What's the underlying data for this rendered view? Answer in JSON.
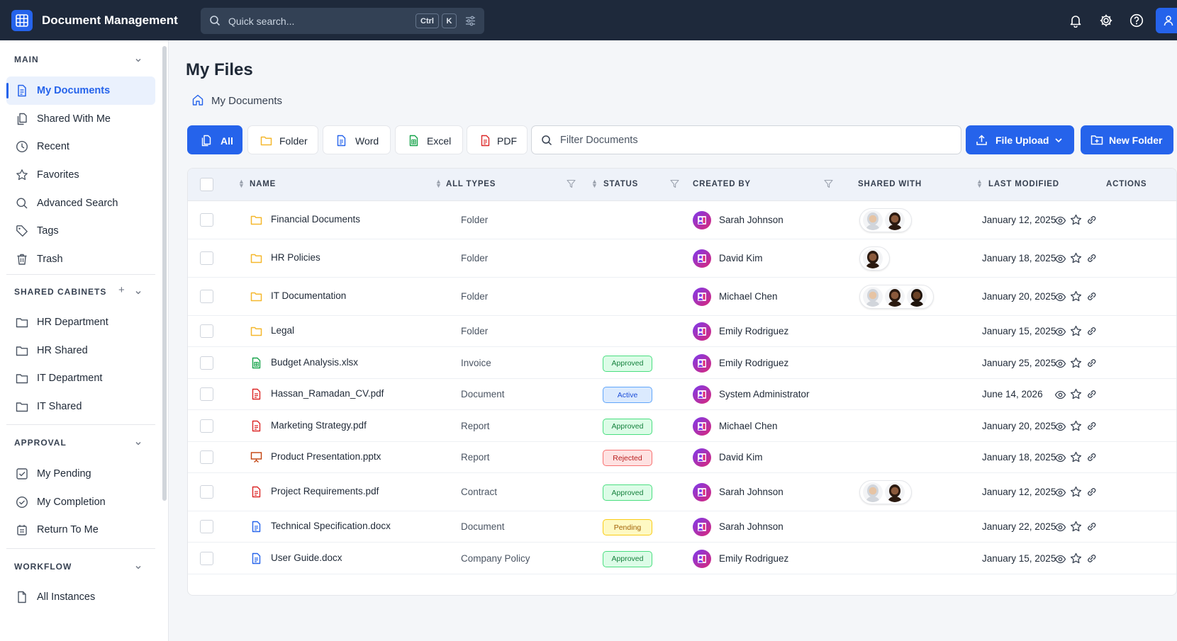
{
  "app": {
    "title": "Document Management"
  },
  "search": {
    "placeholder": "Quick search...",
    "kbd_ctrl": "Ctrl",
    "kbd_k": "K"
  },
  "sidebar": {
    "sections": [
      {
        "title": "MAIN",
        "items": [
          {
            "label": "My Documents",
            "icon": "document-icon",
            "active": true
          },
          {
            "label": "Shared With Me",
            "icon": "shared-files-icon"
          },
          {
            "label": "Recent",
            "icon": "clock-icon"
          },
          {
            "label": "Favorites",
            "icon": "star-icon"
          },
          {
            "label": "Advanced Search",
            "icon": "search-icon"
          },
          {
            "label": "Tags",
            "icon": "tag-icon"
          },
          {
            "label": "Trash",
            "icon": "trash-icon"
          }
        ]
      },
      {
        "title": "SHARED CABINETS",
        "items": [
          {
            "label": "HR Department",
            "icon": "folder-icon"
          },
          {
            "label": "HR Shared",
            "icon": "folder-icon"
          },
          {
            "label": "IT Department",
            "icon": "folder-icon"
          },
          {
            "label": "IT Shared",
            "icon": "folder-icon"
          }
        ]
      },
      {
        "title": "APPROVAL",
        "items": [
          {
            "label": "My Pending",
            "icon": "checkbox-icon"
          },
          {
            "label": "My Completion",
            "icon": "check-circle-icon"
          },
          {
            "label": "Return To Me",
            "icon": "return-icon"
          }
        ]
      },
      {
        "title": "WORKFLOW",
        "items": [
          {
            "label": "All Instances",
            "icon": "instances-icon"
          }
        ]
      }
    ]
  },
  "main": {
    "title": "My Files",
    "breadcrumb": "My Documents",
    "filters": [
      {
        "label": "All",
        "icon": "files-icon",
        "active": true
      },
      {
        "label": "Folder",
        "icon": "folder-icon"
      },
      {
        "label": "Word",
        "icon": "word-icon"
      },
      {
        "label": "Excel",
        "icon": "excel-icon"
      },
      {
        "label": "PDF",
        "icon": "pdf-icon"
      }
    ],
    "filter_placeholder": "Filter Documents",
    "upload_label": "File Upload",
    "new_folder_label": "New Folder"
  },
  "table": {
    "headers": {
      "name": "NAME",
      "types": "ALL TYPES",
      "status": "STATUS",
      "created_by": "CREATED BY",
      "shared_with": "SHARED WITH",
      "last_modified": "LAST MODIFIED",
      "actions": "ACTIONS"
    },
    "rows": [
      {
        "name": "Financial Documents",
        "kind": "folder",
        "type": "Folder",
        "status": "",
        "creator": "Sarah Johnson",
        "shared": 2,
        "modified": "January 12, 2025"
      },
      {
        "name": "HR Policies",
        "kind": "folder",
        "type": "Folder",
        "status": "",
        "creator": "David Kim",
        "shared": 1,
        "modified": "January 18, 2025"
      },
      {
        "name": "IT Documentation",
        "kind": "folder",
        "type": "Folder",
        "status": "",
        "creator": "Michael Chen",
        "shared": 3,
        "modified": "January 20, 2025"
      },
      {
        "name": "Legal",
        "kind": "folder",
        "type": "Folder",
        "status": "",
        "creator": "Emily Rodriguez",
        "shared": 0,
        "modified": "January 15, 2025"
      },
      {
        "name": "Budget Analysis.xlsx",
        "kind": "excel",
        "type": "Invoice",
        "status": "Approved",
        "creator": "Emily Rodriguez",
        "shared": 0,
        "modified": "January 25, 2025"
      },
      {
        "name": "Hassan_Ramadan_CV.pdf",
        "kind": "pdf",
        "type": "Document",
        "status": "Active",
        "creator": "System Administrator",
        "shared": 0,
        "modified": "June 14, 2026"
      },
      {
        "name": "Marketing Strategy.pdf",
        "kind": "pdf",
        "type": "Report",
        "status": "Approved",
        "creator": "Michael Chen",
        "shared": 0,
        "modified": "January 20, 2025"
      },
      {
        "name": "Product Presentation.pptx",
        "kind": "ppt",
        "type": "Report",
        "status": "Rejected",
        "creator": "David Kim",
        "shared": 0,
        "modified": "January 18, 2025"
      },
      {
        "name": "Project Requirements.pdf",
        "kind": "pdf",
        "type": "Contract",
        "status": "Approved",
        "creator": "Sarah Johnson",
        "shared": 2,
        "modified": "January 12, 2025"
      },
      {
        "name": "Technical Specification.docx",
        "kind": "word",
        "type": "Document",
        "status": "Pending",
        "creator": "Sarah Johnson",
        "shared": 0,
        "modified": "January 22, 2025"
      },
      {
        "name": "User Guide.docx",
        "kind": "word",
        "type": "Company Policy",
        "status": "Approved",
        "creator": "Emily Rodriguez",
        "shared": 0,
        "modified": "January 15, 2025"
      }
    ]
  },
  "colors": {
    "primary": "#2563eb",
    "topbar": "#1e293b",
    "folder": "#f5b82e",
    "excel": "#16a34a",
    "pdf": "#dc2626",
    "word": "#2563eb",
    "ppt": "#c2410c"
  }
}
